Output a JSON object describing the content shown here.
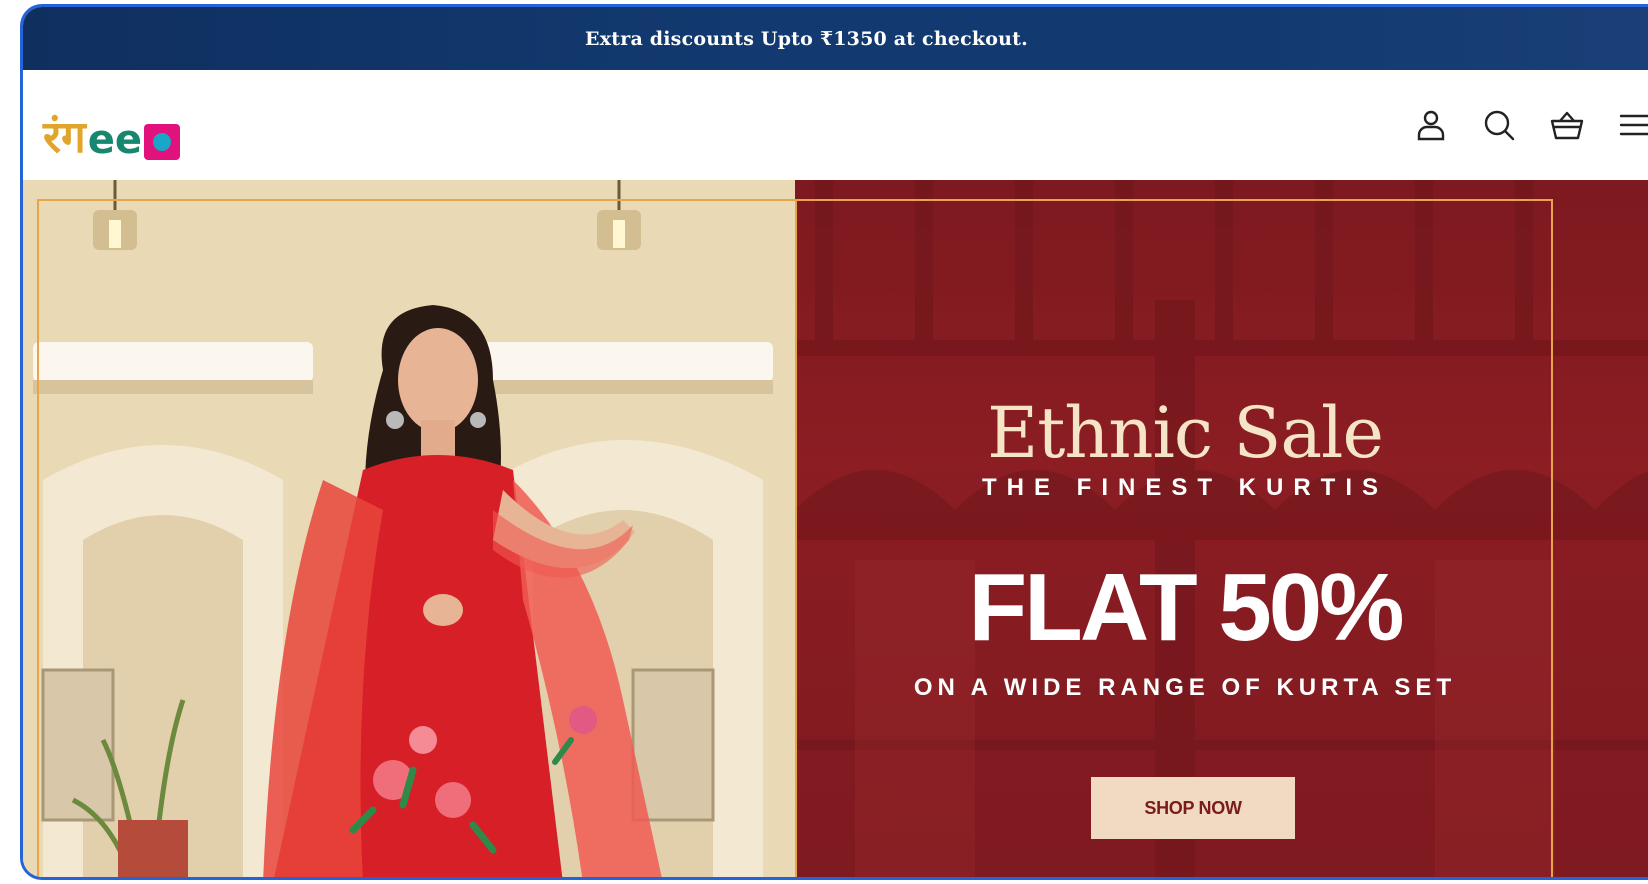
{
  "announcement": {
    "text": "Extra discounts Upto ₹1350 at checkout."
  },
  "header": {
    "logo": {
      "glyph": "रंग",
      "ee": "ee",
      "brand": "रंगeela"
    },
    "icons": [
      "account-icon",
      "search-icon",
      "cart-icon",
      "menu-icon"
    ]
  },
  "hero": {
    "title": "Ethnic Sale",
    "subtitle": "THE FINEST KURTIS",
    "offer": "FLAT 50%",
    "offer_detail": "ON A WIDE RANGE OF KURTA SET",
    "cta_label": "SHOP NOW"
  },
  "colors": {
    "announce_bg": "#123a70",
    "panel_bg": "#8b1d23",
    "border_accent": "#e9a349",
    "button_bg": "#f1d9c2",
    "title_cream": "#f6e4c7",
    "logo_gold": "#e0a52a",
    "logo_green": "#17876f",
    "logo_pink": "#e2127c"
  }
}
